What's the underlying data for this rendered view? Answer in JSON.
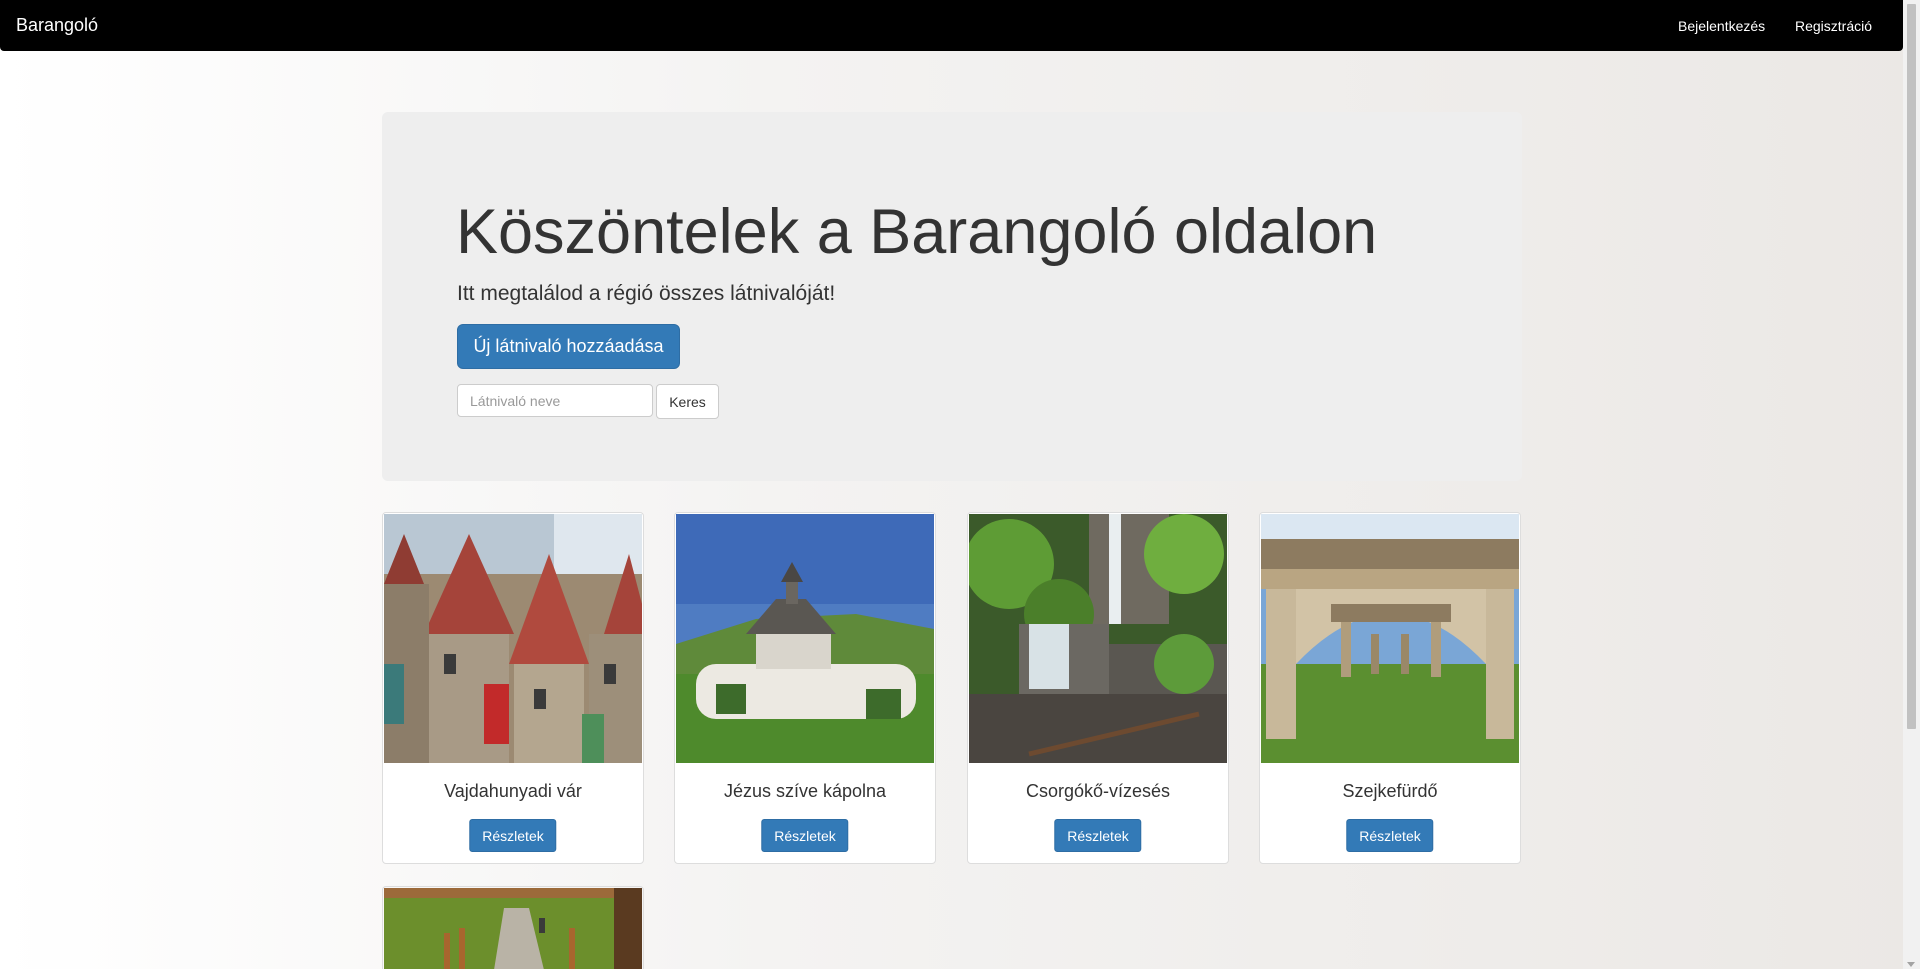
{
  "navbar": {
    "brand": "Barangoló",
    "links": [
      "Bejelentkezés",
      "Regisztráció"
    ]
  },
  "hero": {
    "title": "Köszöntelek a Barangoló oldalon",
    "subtitle": "Itt megtalálod a régió összes látnivalóját!",
    "add_button": "Új látnivaló hozzáadása",
    "search_placeholder": "Látnivaló neve",
    "search_button": "Keres"
  },
  "cards": [
    {
      "title": "Vajdahunyadi vár",
      "button": "Részletek"
    },
    {
      "title": "Jézus szíve kápolna",
      "button": "Részletek"
    },
    {
      "title": "Csorgókő-vízesés",
      "button": "Részletek"
    },
    {
      "title": "Szejkefürdő",
      "button": "Részletek"
    }
  ],
  "colors": {
    "navbar": "#000000",
    "primary": "#337ab7",
    "jumbotron": "#eeeeee"
  }
}
